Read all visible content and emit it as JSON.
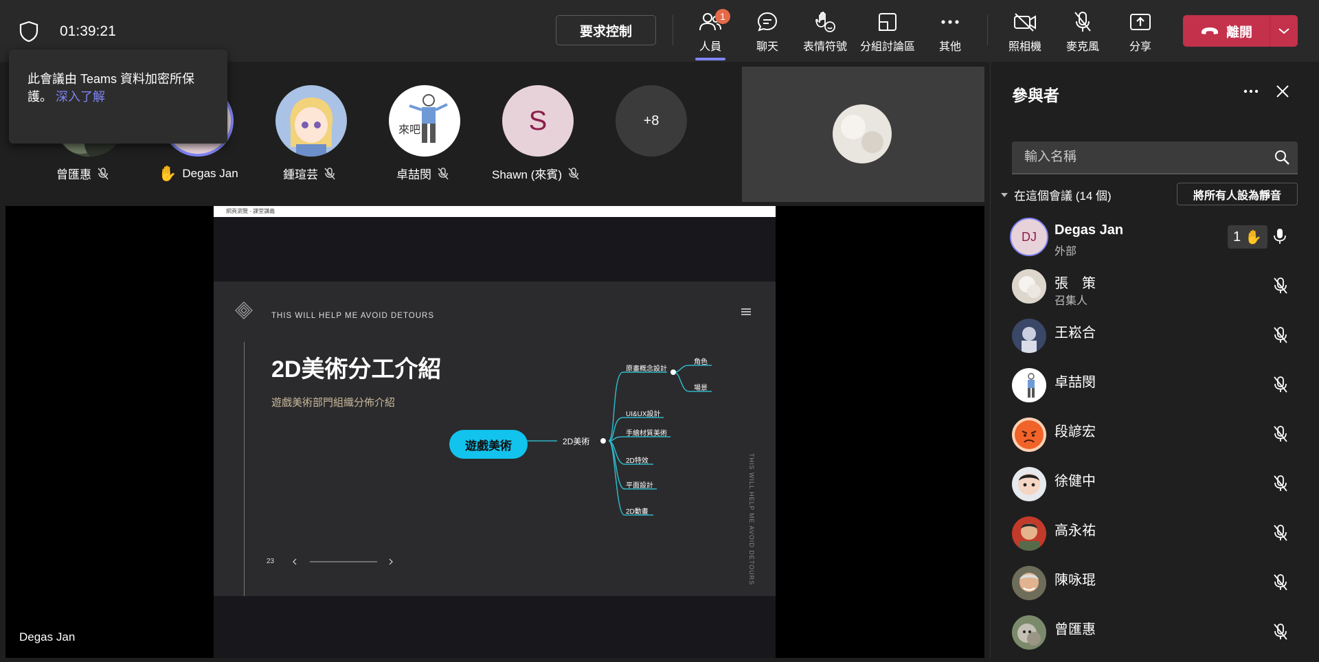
{
  "topbar": {
    "timer": "01:39:21",
    "request_control": "要求控制",
    "people": {
      "label": "人員",
      "badge": "1"
    },
    "chat": {
      "label": "聊天"
    },
    "reactions": {
      "label": "表情符號"
    },
    "breakout": {
      "label": "分組討論區"
    },
    "more": {
      "label": "其他"
    },
    "camera": {
      "label": "照相機"
    },
    "mic": {
      "label": "麥克風"
    },
    "share": {
      "label": "分享"
    },
    "leave": {
      "label": "離開"
    }
  },
  "tooltip": {
    "text": "此會議由 Teams 資料加密所保護。",
    "link": "深入了解"
  },
  "gallery": {
    "tiles": [
      {
        "name": "曾匯惠",
        "muted": true
      },
      {
        "name": "Degas Jan",
        "hand_raised": true
      },
      {
        "name": "鍾瑄芸",
        "muted": true
      },
      {
        "name": "卓喆閔",
        "muted": true
      },
      {
        "name": "Shawn (來賓)",
        "muted": true,
        "initial": "S"
      }
    ],
    "more_count": "+8"
  },
  "stage": {
    "presenter_name": "Degas Jan",
    "window_title": "網頁瀏覽 - 課堂講義",
    "slide": {
      "tagline": "THIS WILL HELP ME AVOID DETOURS",
      "title": "2D美術分工介紹",
      "subtitle": "遊戲美術部門組織分佈介紹",
      "page_number": "23",
      "side_text": "THIS WILL HELP ME AVOID DETOURS",
      "mindmap": {
        "root": "遊戲美術",
        "branch": "2D美術",
        "children": [
          "原畫概念設計",
          "UI&UX設計",
          "手繪材質美術",
          "2D特效",
          "平面設計",
          "2D動畫"
        ],
        "sub_children": [
          "角色",
          "場景"
        ]
      }
    }
  },
  "panel": {
    "title": "參與者",
    "search_placeholder": "輸入名稱",
    "section_label": "在這個會議 (14 個)",
    "mute_all": "將所有人設為靜音",
    "participants": [
      {
        "name": "Degas Jan",
        "sub": "外部",
        "initials": "DJ",
        "hand_count": "1"
      },
      {
        "name": "張　策",
        "sub": "召集人"
      },
      {
        "name": "王崧合",
        "sub": ""
      },
      {
        "name": "卓喆閔",
        "sub": ""
      },
      {
        "name": "段諺宏",
        "sub": ""
      },
      {
        "name": "徐健中",
        "sub": ""
      },
      {
        "name": "高永祐",
        "sub": ""
      },
      {
        "name": "陳咏琨",
        "sub": ""
      },
      {
        "name": "曾匯惠",
        "sub": ""
      }
    ]
  },
  "colors": {
    "accent": "#7f85f5",
    "leave": "#c4314b",
    "badge": "#e66a48",
    "mindmap": "#2fb8c8"
  }
}
